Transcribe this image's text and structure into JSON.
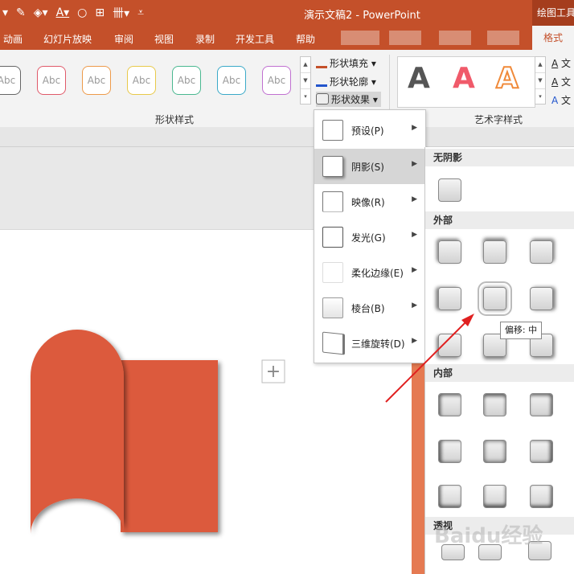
{
  "app": {
    "title": "演示文稿2 - PowerPoint",
    "context_tab": "绘图工具",
    "accent": "#c4502a"
  },
  "tabs": [
    "动画",
    "幻灯片放映",
    "审阅",
    "视图",
    "录制",
    "开发工具",
    "帮助"
  ],
  "active_tab": "格式",
  "ribbon": {
    "shape_styles": {
      "group_label": "形状样式",
      "swatch_text": "Abc",
      "swatch_colors": [
        "#666666",
        "#e05a6a",
        "#ed9a4a",
        "#e8c94a",
        "#4ab890",
        "#3aa9c8",
        "#c070d0"
      ]
    },
    "commands": {
      "fill": "形状填充",
      "outline": "形状轮廓",
      "effects": "形状效果"
    },
    "wordart": {
      "group_label": "艺术字样式",
      "sample_glyph": "A",
      "side_label": "文"
    }
  },
  "effects_menu": {
    "items": [
      {
        "label": "预设(P)"
      },
      {
        "label": "阴影(S)",
        "active": true
      },
      {
        "label": "映像(R)"
      },
      {
        "label": "发光(G)"
      },
      {
        "label": "柔化边缘(E)"
      },
      {
        "label": "棱台(B)"
      },
      {
        "label": "三维旋转(D)"
      }
    ]
  },
  "shadow_submenu": {
    "sections": [
      "无阴影",
      "外部",
      "内部",
      "透视"
    ],
    "selected": "偏移: 中"
  },
  "watermark": "Baidu经验",
  "shape_color": "#dc5a3c"
}
